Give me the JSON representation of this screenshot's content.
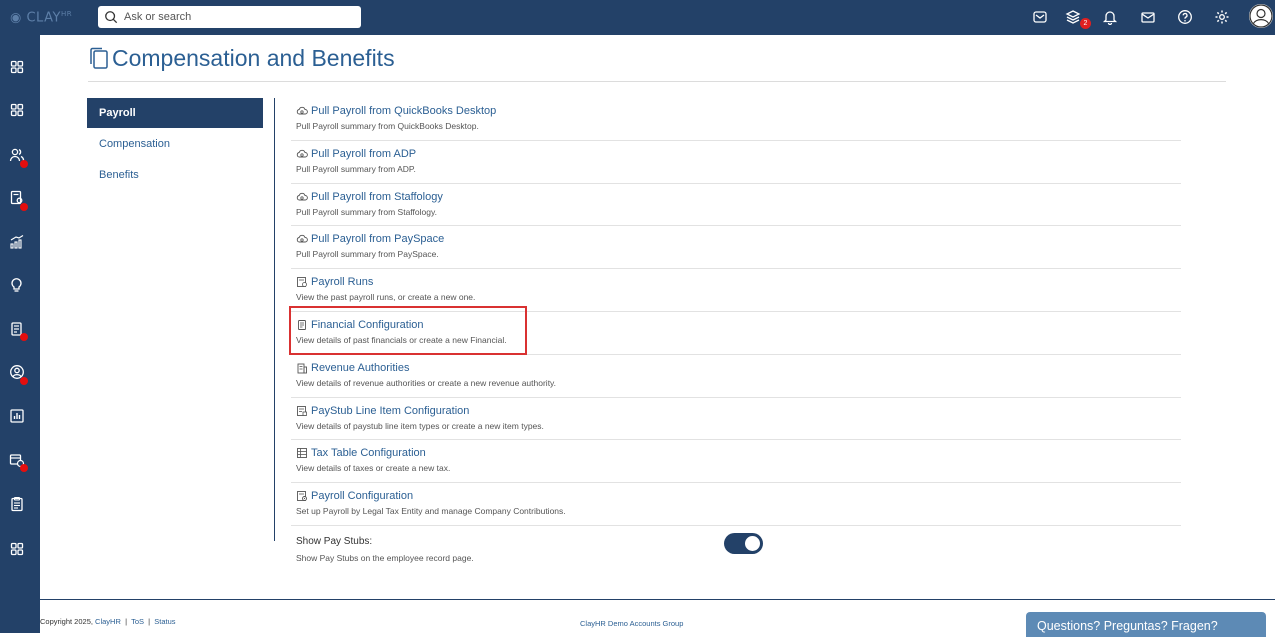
{
  "app": {
    "logo_text": "CLAY",
    "logo_suffix": "HR"
  },
  "search": {
    "placeholder": "Ask or search"
  },
  "topbar": {
    "notification_count": "2"
  },
  "page": {
    "title": "Compensation and Benefits"
  },
  "leftnav": {
    "items": [
      {
        "label": "Payroll",
        "active": true
      },
      {
        "label": "Compensation",
        "active": false
      },
      {
        "label": "Benefits",
        "active": false
      }
    ]
  },
  "items": [
    {
      "title": "Pull Payroll from QuickBooks Desktop",
      "desc": "Pull Payroll summary from QuickBooks Desktop.",
      "icon": "cloud-sync-icon"
    },
    {
      "title": "Pull Payroll from ADP",
      "desc": "Pull Payroll summary from ADP.",
      "icon": "cloud-sync-icon"
    },
    {
      "title": "Pull Payroll from Staffology",
      "desc": "Pull Payroll summary from Staffology.",
      "icon": "cloud-sync-icon"
    },
    {
      "title": "Pull Payroll from PaySpace",
      "desc": "Pull Payroll summary from PaySpace.",
      "icon": "cloud-sync-icon"
    },
    {
      "title": "Payroll Runs",
      "desc": "View the past payroll runs, or create a new one.",
      "icon": "payroll-runs-icon"
    },
    {
      "title": "Financial Configuration",
      "desc": "View details of past financials or create a new Financial.",
      "icon": "financial-doc-icon"
    },
    {
      "title": "Revenue Authorities",
      "desc": "View details of revenue authorities or create a new revenue authority.",
      "icon": "building-icon"
    },
    {
      "title": "PayStub Line Item Configuration",
      "desc": "View details of paystub line item types or create a new item types.",
      "icon": "paystub-icon"
    },
    {
      "title": "Tax Table Configuration",
      "desc": "View details of taxes or create a new tax.",
      "icon": "table-icon"
    },
    {
      "title": "Payroll Configuration",
      "desc": "Set up Payroll by Legal Tax Entity and manage Company Contributions.",
      "icon": "payroll-config-icon"
    }
  ],
  "paystubs": {
    "label": "Show Pay Stubs:",
    "desc": "Show Pay Stubs on the employee record page.",
    "enabled": true
  },
  "footer": {
    "copyright": "Copyright 2025,",
    "brand_link": "ClayHR",
    "sep1": "|",
    "tos": "ToS",
    "sep2": "|",
    "status": "Status",
    "group": "ClayHR Demo Accounts Group"
  },
  "help": {
    "label": "Questions? Preguntas? Fragen?"
  },
  "colors": {
    "nav_bg": "#234168",
    "link": "#2b5f93",
    "highlight": "#d93131",
    "badge": "#e02020"
  }
}
